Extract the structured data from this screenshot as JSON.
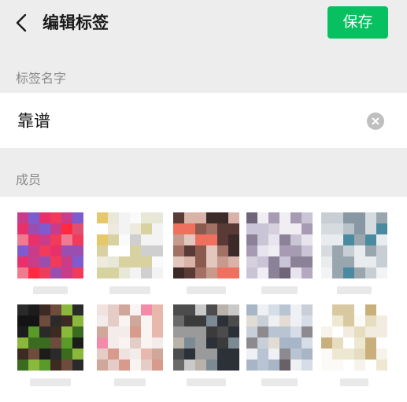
{
  "header": {
    "back_icon": "chevron-left-icon",
    "title": "编辑标签",
    "save_label": "保存",
    "accent": "#07c160"
  },
  "tag_name": {
    "section_label": "标签名字",
    "value": "靠谱",
    "clear_icon": "clear-circle-icon"
  },
  "members": {
    "section_label": "成员",
    "count": 10
  }
}
